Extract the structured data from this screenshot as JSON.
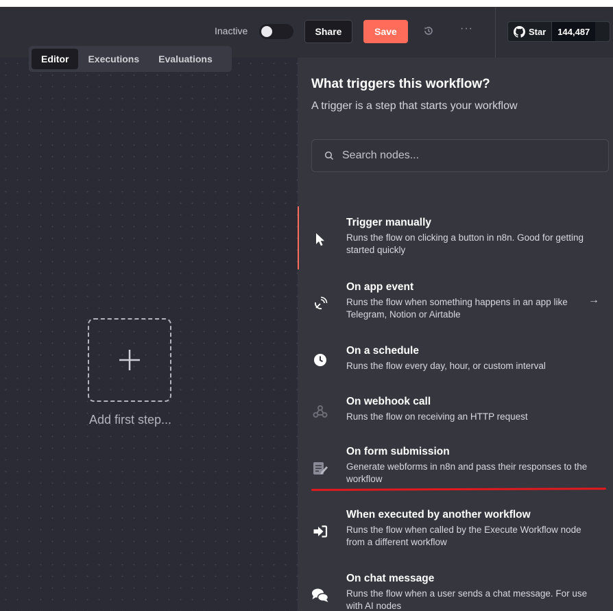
{
  "header": {
    "status_label": "Inactive",
    "share_label": "Share",
    "save_label": "Save",
    "more_label": "···",
    "github": {
      "star_label": "Star",
      "star_count": "144,487"
    }
  },
  "tabs": [
    {
      "label": "Editor",
      "active": true
    },
    {
      "label": "Executions",
      "active": false
    },
    {
      "label": "Evaluations",
      "active": false
    }
  ],
  "canvas": {
    "add_first_step_label": "Add first step..."
  },
  "panel": {
    "title": "What triggers this workflow?",
    "subtitle": "A trigger is a step that starts your workflow",
    "search_placeholder": "Search nodes...",
    "items": [
      {
        "name": "Trigger manually",
        "description": "Runs the flow on clicking a button in n8n. Good for getting started quickly",
        "icon": "cursor-icon"
      },
      {
        "name": "On app event",
        "description": "Runs the flow when something happens in an app like Telegram, Notion or Airtable",
        "icon": "satellite-icon",
        "arrow": "→"
      },
      {
        "name": "On a schedule",
        "description": "Runs the flow every day, hour, or custom interval",
        "icon": "clock-icon"
      },
      {
        "name": "On webhook call",
        "description": "Runs the flow on receiving an HTTP request",
        "icon": "webhook-icon"
      },
      {
        "name": "On form submission",
        "description": "Generate webforms in n8n and pass their responses to the workflow",
        "icon": "form-icon"
      },
      {
        "name": "When executed by another workflow",
        "description": "Runs the flow when called by the Execute Workflow node from a different workflow",
        "icon": "sign-in-icon"
      },
      {
        "name": "On chat message",
        "description": "Runs the flow when a user sends a chat message. For use with AI nodes",
        "icon": "chat-icon"
      }
    ]
  },
  "colors": {
    "accent": "#ff6d5a",
    "annotation_underline": "#e2191e",
    "canvas_bg": "#2b2b36",
    "panel_bg": "#36363f"
  }
}
